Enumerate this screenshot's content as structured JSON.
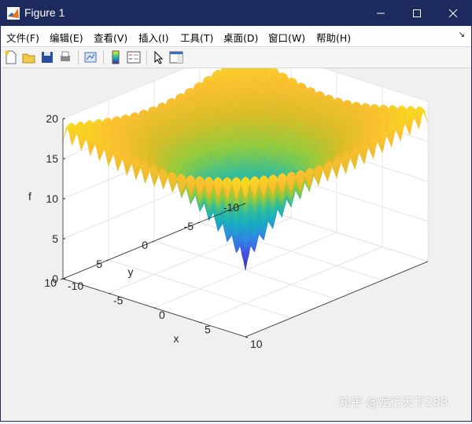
{
  "window": {
    "title": "Figure 1"
  },
  "menu": {
    "items": [
      "文件(F)",
      "编辑(E)",
      "查看(V)",
      "插入(I)",
      "工具(T)",
      "桌面(D)",
      "窗口(W)",
      "帮助(H)"
    ]
  },
  "toolbar": {
    "buttons": [
      "new-figure-icon",
      "open-file-icon",
      "save-icon",
      "print-icon",
      "link-plot-icon",
      "insert-colorbar-icon",
      "insert-legend-icon",
      "edit-plot-pointer-icon",
      "property-editor-icon"
    ]
  },
  "plot": {
    "xlabel": "x",
    "ylabel": "y",
    "zlabel": "f",
    "xticks": [
      "-10",
      "-5",
      "0",
      "5",
      "10"
    ],
    "yticks": [
      "-10",
      "-5",
      "0",
      "5",
      "10"
    ],
    "zticks": [
      "0",
      "5",
      "10",
      "15",
      "20"
    ]
  },
  "watermark": "知乎 @龙行天下288",
  "chart_data": {
    "type": "surface",
    "function": "Ackley",
    "xlim": [
      -10,
      10
    ],
    "ylim": [
      -10,
      10
    ],
    "zlim": [
      0,
      20
    ],
    "grid": true,
    "colormap": "parula",
    "colors": [
      "#3e26a8",
      "#2d8ce0",
      "#1ab9b0",
      "#8fcc3e",
      "#f9c32b",
      "#f5e21a"
    ]
  }
}
